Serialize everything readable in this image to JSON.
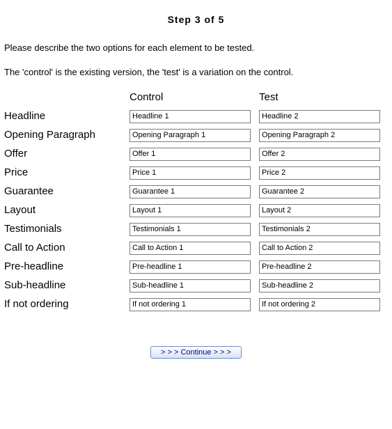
{
  "title": "Step 3 of 5",
  "intro1": "Please describe the two options for each element to be tested.",
  "intro2": "The 'control' is the existing version, the 'test' is a variation on the control.",
  "headers": {
    "control": "Control",
    "test": "Test"
  },
  "rows": [
    {
      "label": "Headline",
      "control": "Headline 1",
      "test": "Headline 2"
    },
    {
      "label": "Opening Paragraph",
      "control": "Opening Paragraph 1",
      "test": "Opening Paragraph 2"
    },
    {
      "label": "Offer",
      "control": "Offer 1",
      "test": "Offer 2"
    },
    {
      "label": "Price",
      "control": "Price 1",
      "test": "Price 2"
    },
    {
      "label": "Guarantee",
      "control": "Guarantee 1",
      "test": "Guarantee 2"
    },
    {
      "label": "Layout",
      "control": "Layout 1",
      "test": "Layout 2"
    },
    {
      "label": "Testimonials",
      "control": "Testimonials 1",
      "test": "Testimonials 2"
    },
    {
      "label": "Call to Action",
      "control": "Call to Action 1",
      "test": "Call to Action 2"
    },
    {
      "label": "Pre-headline",
      "control": "Pre-headline 1",
      "test": "Pre-headline 2"
    },
    {
      "label": "Sub-headline",
      "control": "Sub-headline 1",
      "test": "Sub-headline 2"
    },
    {
      "label": "If not ordering",
      "control": "If not ordering 1",
      "test": "If not ordering 2"
    }
  ],
  "continue_label": "> > > Continue > > >"
}
